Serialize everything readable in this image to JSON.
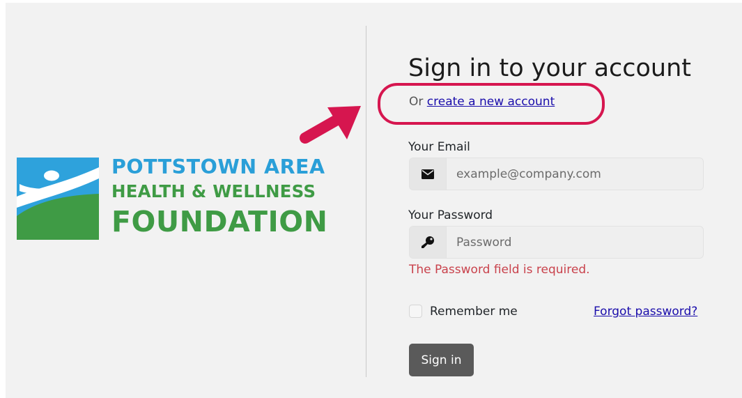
{
  "logo": {
    "line1": "POTTSTOWN AREA",
    "line2": "HEALTH & WELLNESS",
    "line3": "FOUNDATION",
    "colors": {
      "blue": "#2a9fd8",
      "green": "#3f9b45"
    }
  },
  "form": {
    "title": "Sign in to your account",
    "or_prefix": "Or",
    "create_link": "create a new account",
    "email_label": "Your Email",
    "email_placeholder": "example@company.com",
    "email_icon": "envelope-icon",
    "password_label": "Your Password",
    "password_placeholder": "Password",
    "password_icon": "key-icon",
    "password_error": "The Password field is required.",
    "remember_label": "Remember me",
    "remember_checked": false,
    "forgot_link": "Forgot password?",
    "submit_label": "Sign in"
  },
  "annotation": {
    "arrow_color": "#d6164f",
    "highlight_color": "#d6164f"
  }
}
